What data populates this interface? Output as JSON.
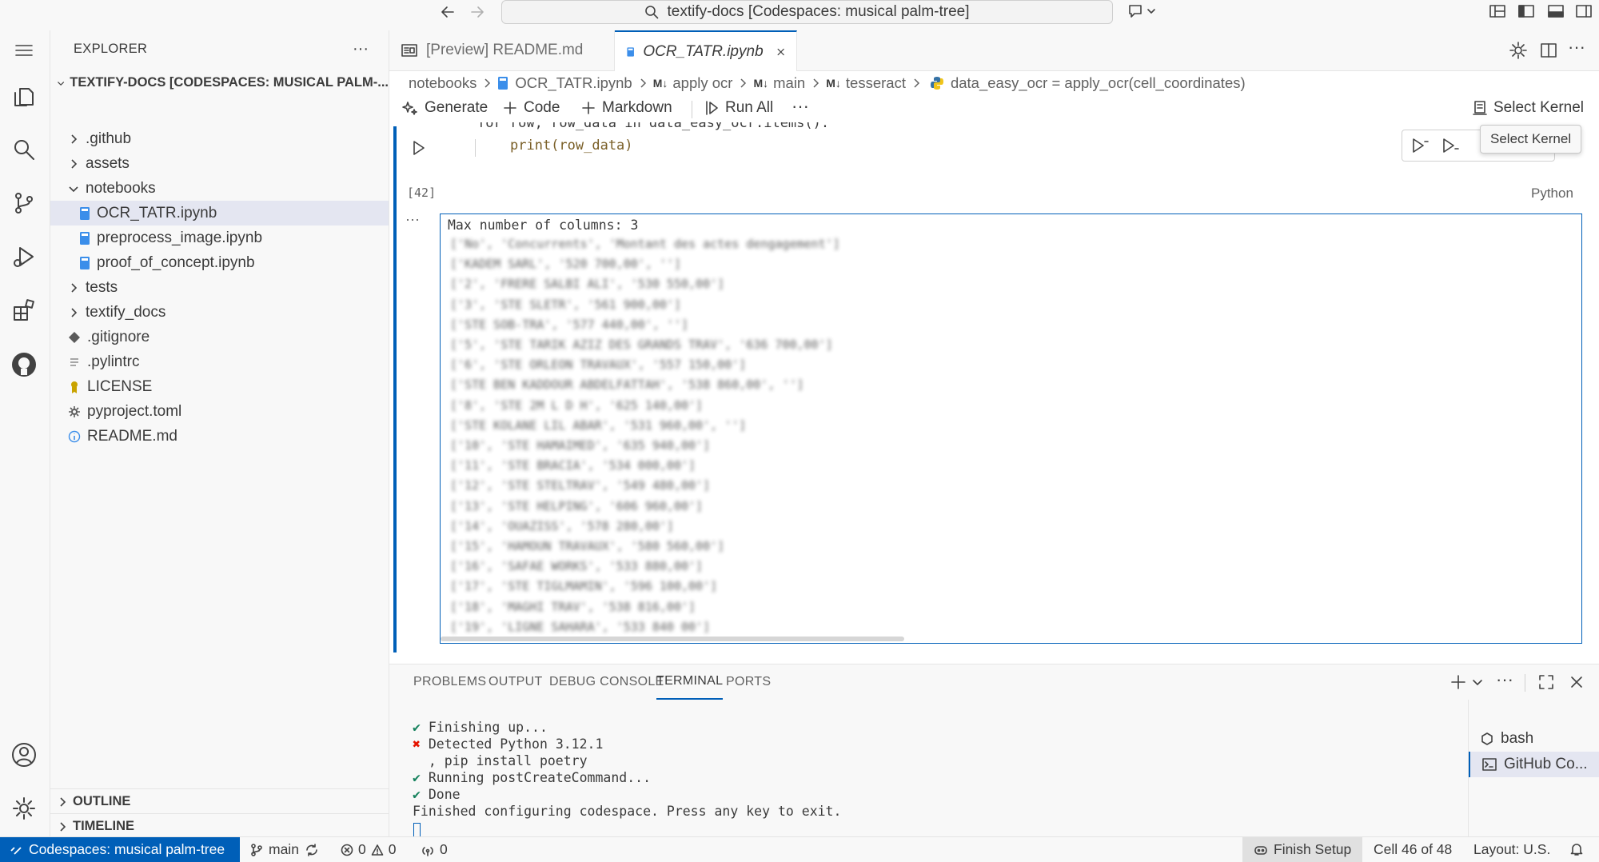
{
  "titlebar": {
    "search_text": "textify-docs [Codespaces: musical palm-tree]"
  },
  "sidebar": {
    "header": "EXPLORER",
    "root": "TEXTIFY-DOCS [CODESPACES: MUSICAL PALM-...",
    "items": [
      {
        "label": ".github",
        "type": "folder",
        "open": false
      },
      {
        "label": "assets",
        "type": "folder",
        "open": false
      },
      {
        "label": "notebooks",
        "type": "folder",
        "open": true
      },
      {
        "label": "OCR_TATR.ipynb",
        "type": "notebook",
        "selected": true
      },
      {
        "label": "preprocess_image.ipynb",
        "type": "notebook"
      },
      {
        "label": "proof_of_concept.ipynb",
        "type": "notebook"
      },
      {
        "label": "tests",
        "type": "folder",
        "open": false
      },
      {
        "label": "textify_docs",
        "type": "folder",
        "open": false
      },
      {
        "label": ".gitignore",
        "type": "git"
      },
      {
        "label": ".pylintrc",
        "type": "text"
      },
      {
        "label": "LICENSE",
        "type": "license"
      },
      {
        "label": "pyproject.toml",
        "type": "settings"
      },
      {
        "label": "README.md",
        "type": "info"
      }
    ],
    "outline": "OUTLINE",
    "timeline": "TIMELINE"
  },
  "tabs": [
    {
      "label": "[Preview] README.md",
      "active": false
    },
    {
      "label": "OCR_TATR.ipynb",
      "active": true
    }
  ],
  "breadcrumbs": [
    "notebooks",
    "OCR_TATR.ipynb",
    "apply ocr",
    "main",
    "tesseract",
    "data_easy_ocr = apply_ocr(cell_coordinates)"
  ],
  "breadcrumb_md_prefix": "M↓",
  "toolbar": {
    "generate": "Generate",
    "code": "Code",
    "markdown": "Markdown",
    "run_all": "Run All",
    "select_kernel": "Select Kernel",
    "tooltip": "Select Kernel"
  },
  "cell": {
    "code_line1": "for row, row_data in data_easy_ocr.items():",
    "code_line2": "print(row_data)",
    "exec_count": "[42]",
    "language": "Python",
    "output_first": "Max number of columns: 3",
    "output_lines": [
      "['No', 'Concurrents', 'Montant des actes dengagement']",
      "['KADEM SARL', '520 700,00', '']",
      "['2', 'FRERE SALBI ALI', '530 550,00']",
      "['3', 'STE SLETR', '561 900,00']",
      "['STE SOB-TRA', '577 440,00', '']",
      "['5', 'STE TARIK AZIZ DES GRANDS TRAV', '636 700,00']",
      "['6', 'STE ORLEON TRAVAUX', '557 150,00']",
      "['STE BEN KADDOUR ABDELFATTAH', '538 860,00', '']",
      "['8', 'STE 2M L D H', '625 140,00']",
      "['STE KOLANE LIL ABAR', '531 960,00', '']",
      "['10', 'STE HAMAIMED', '635 940,00']",
      "['11', 'STE BRACIA', '534 000,00']",
      "['12', 'STE STELTRAV', '549 480,00']",
      "['13', 'STE HELPING', '606 960,00']",
      "['14', 'OUAZISS', '578 280,00']",
      "['15', 'HAMOUN TRAVAUX', '580 560,00']",
      "['16', 'SAFAE WORKS', '533 880,00']",
      "['17', 'STE TIGLMAMIN', '596 100,00']",
      "['18', 'MAGHI TRAV', '538 816,00']",
      "['19', 'LIGNE SAHARA', '533 840 00']"
    ]
  },
  "panel": {
    "tabs": [
      "PROBLEMS",
      "OUTPUT",
      "DEBUG CONSOLE",
      "TERMINAL",
      "PORTS"
    ],
    "active_tab": "TERMINAL",
    "terminal": [
      {
        "mark": "✔",
        "color": "#16825d",
        "text": "Finishing up..."
      },
      {
        "mark": "✖",
        "color": "#e51400",
        "text": "Detected Python 3.12.1"
      },
      {
        "mark": "",
        "color": "",
        "text": "  , pip install poetry"
      },
      {
        "mark": "✔",
        "color": "#16825d",
        "text": "Running postCreateCommand..."
      },
      {
        "mark": "✔",
        "color": "#16825d",
        "text": "Done"
      },
      {
        "mark": "",
        "color": "",
        "text": "Finished configuring codespace. Press any key to exit."
      }
    ],
    "terminals": [
      "bash",
      "GitHub Co..."
    ]
  },
  "statusbar": {
    "remote": "Codespaces: musical palm-tree",
    "branch": "main",
    "errors": "0",
    "warnings": "0",
    "ports": "0",
    "finish_setup": "Finish Setup",
    "cell": "Cell 46 of 48",
    "layout": "Layout: U.S."
  },
  "colors": {
    "accent": "#005fb8",
    "remote_bg": "#005fb8",
    "selected_row": "#e4e6f1"
  }
}
